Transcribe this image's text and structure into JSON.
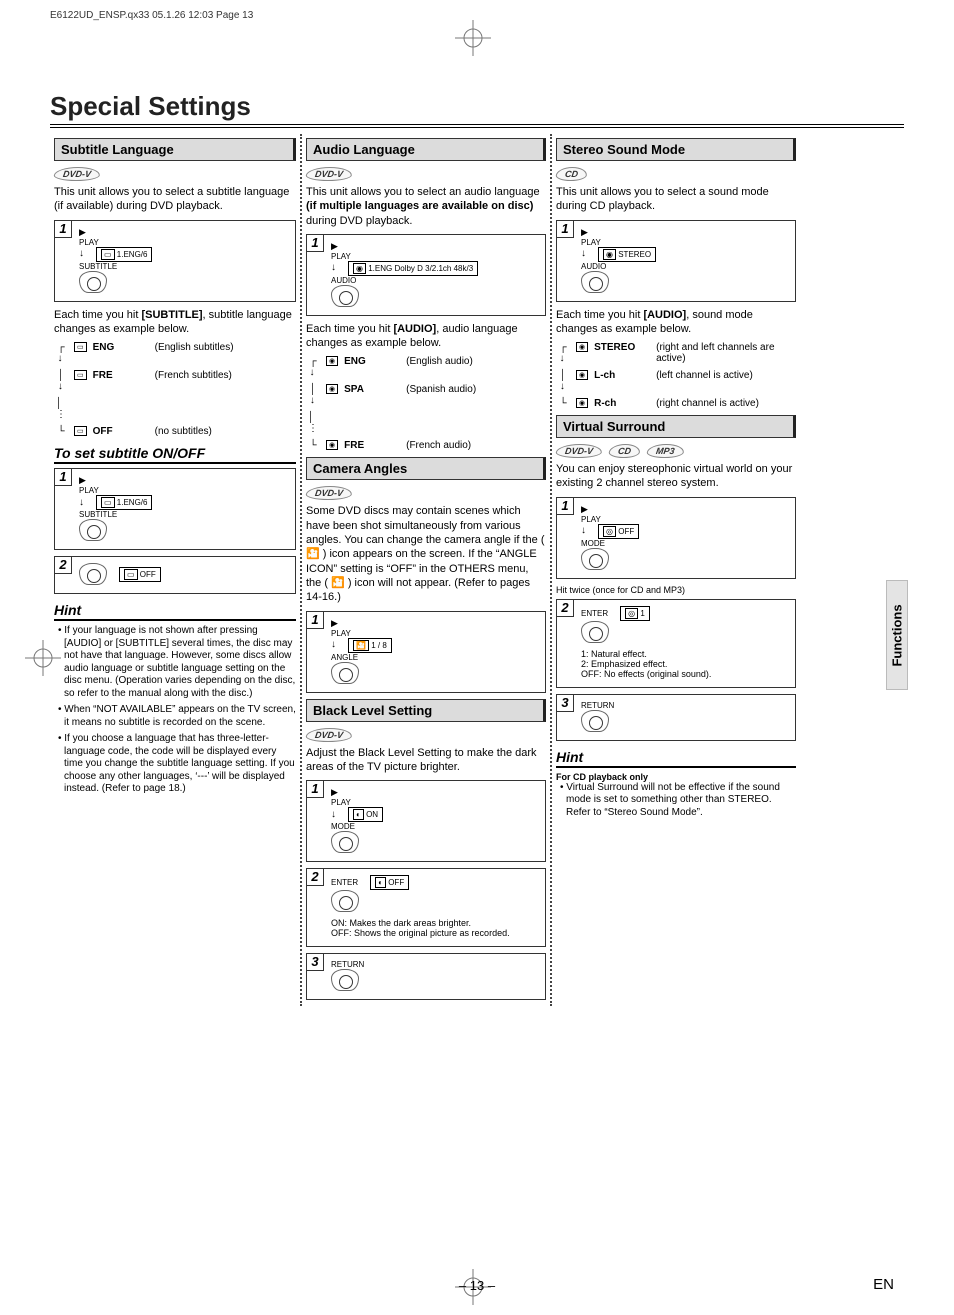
{
  "meta": {
    "print_tag": "E6122UD_ENSP.qx33  05.1.26 12:03  Page 13",
    "page_number": "– 13 –",
    "lang_tag": "EN",
    "side_tab": "Functions",
    "title": "Special Settings"
  },
  "col1": {
    "subtitle_hdr": "Subtitle Language",
    "badge_dvd": "DVD-V",
    "intro": "This unit allows you to select a subtitle language (if available) during DVD playback.",
    "step1_play": "PLAY",
    "step1_btn": "SUBTITLE",
    "step1_osd": "1.ENG/6",
    "after_step": "Each time you hit ",
    "after_step_btn": "[SUBTITLE]",
    "after_step2": ", subtitle language changes as example below.",
    "seq": [
      {
        "code": "ENG",
        "desc": "(English subtitles)"
      },
      {
        "code": "FRE",
        "desc": "(French subtitles)"
      },
      {
        "code": "OFF",
        "desc": "(no subtitles)"
      }
    ],
    "onoff_hdr": "To set subtitle ON/OFF",
    "onoff_step1_play": "PLAY",
    "onoff_step1_btn": "SUBTITLE",
    "onoff_step1_osd": "1.ENG/6",
    "onoff_step2_osd": "OFF",
    "hint_hdr": "Hint",
    "hints": [
      "If your language is not shown after pressing [AUDIO] or [SUBTITLE] several times, the disc may not have that language. However, some discs allow audio language or subtitle language setting on the disc menu. (Operation varies depending on the disc, so refer to the manual along with the disc.)",
      "When “NOT AVAILABLE” appears on the TV screen, it means no subtitle is recorded on the scene.",
      "If you choose a language that has three-letter-language code, the code will be displayed every time you change the subtitle language setting. If you choose any other languages, ‘---’ will be displayed instead. (Refer to page 18.)"
    ]
  },
  "col2": {
    "audio_hdr": "Audio Language",
    "badge_dvd": "DVD-V",
    "intro1": "This unit allows you to select an audio language ",
    "intro_bold": "(if multiple languages are available on disc)",
    "intro2": " during DVD playback.",
    "step1_play": "PLAY",
    "step1_btn": "AUDIO",
    "step1_osd": "1.ENG Dolby D 3/2.1ch 48k/3",
    "after": "Each time you hit ",
    "after_btn": "[AUDIO]",
    "after2": ", audio language changes as example below.",
    "seq": [
      {
        "code": "ENG",
        "desc": "(English audio)"
      },
      {
        "code": "SPA",
        "desc": "(Spanish audio)"
      },
      {
        "code": "FRE",
        "desc": "(French audio)"
      }
    ],
    "angles_hdr": "Camera Angles",
    "angles_badge": "DVD-V",
    "angles_text": "Some DVD discs may contain scenes which have been shot simultaneously from various angles. You can change the camera angle if the ( 🎦 ) icon appears on the screen. If the “ANGLE ICON” setting is “OFF” in the OTHERS menu, the ( 🎦 ) icon will not appear. (Refer to pages 14-16.)",
    "angles_step_play": "PLAY",
    "angles_step_btn": "ANGLE",
    "angles_osd": "1 / 8",
    "black_hdr": "Black Level Setting",
    "black_badge": "DVD-V",
    "black_text": "Adjust the Black Level Setting to make the dark areas of the TV picture brighter.",
    "black_s1_play": "PLAY",
    "black_s1_btn": "MODE",
    "black_s1_osd": "ON",
    "black_s2_btn": "ENTER",
    "black_s2_osd": "OFF",
    "black_explain": "ON: Makes the dark areas brighter.\nOFF: Shows the original picture as recorded.",
    "black_s3_btn": "RETURN"
  },
  "col3": {
    "stereo_hdr": "Stereo Sound Mode",
    "badge_cd": "CD",
    "stereo_text": "This unit allows you to select a sound mode during CD playback.",
    "stereo_s1_play": "PLAY",
    "stereo_s1_btn": "AUDIO",
    "stereo_s1_osd": "STEREO",
    "stereo_after": "Each time you hit ",
    "stereo_after_btn": "[AUDIO]",
    "stereo_after2": ", sound mode changes as example below.",
    "stereo_seq": [
      {
        "code": "STEREO",
        "desc": "(right and left channels are active)"
      },
      {
        "code": "L-ch",
        "desc": "(left channel is active)"
      },
      {
        "code": "R-ch",
        "desc": "(right channel is active)"
      }
    ],
    "vs_hdr": "Virtual Surround",
    "vs_badges": [
      "DVD-V",
      "CD",
      "MP3"
    ],
    "vs_text": "You can enjoy stereophonic virtual world on your existing 2 channel stereo system.",
    "vs_s1_play": "PLAY",
    "vs_s1_btn": "MODE",
    "vs_s1_osd": "OFF",
    "vs_s1_note": "Hit twice (once for CD and MP3)",
    "vs_s2_btn": "ENTER",
    "vs_s2_osd": "1",
    "vs_effects": "1: Natural effect.\n2: Emphasized effect.\nOFF: No effects (original sound).",
    "vs_s3_btn": "RETURN",
    "hint_hdr": "Hint",
    "hint_sub": "For CD playback only",
    "hint_body": "Virtual Surround will not be effective if the sound mode is set to something other than STEREO. Refer to “Stereo Sound Mode”."
  }
}
